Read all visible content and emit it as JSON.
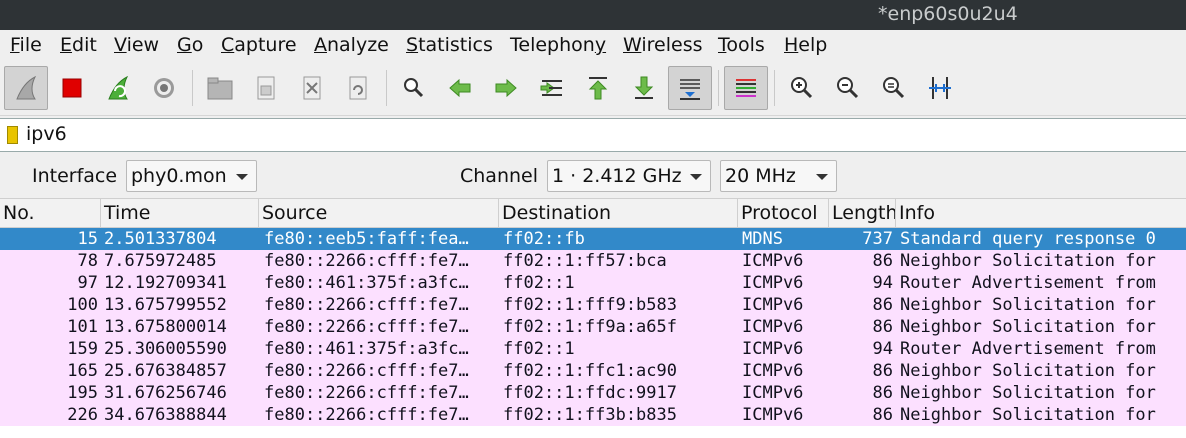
{
  "window": {
    "title": "*enp60s0u2u4"
  },
  "menu": [
    {
      "label": "File",
      "accel": "F",
      "rest": "ile"
    },
    {
      "label": "Edit",
      "accel": "E",
      "rest": "dit"
    },
    {
      "label": "View",
      "accel": "V",
      "rest": "iew"
    },
    {
      "label": "Go",
      "accel": "G",
      "rest": "o"
    },
    {
      "label": "Capture",
      "accel": "C",
      "rest": "apture"
    },
    {
      "label": "Analyze",
      "accel": "A",
      "rest": "nalyze"
    },
    {
      "label": "Statistics",
      "accel": "S",
      "rest": "tatistics"
    },
    {
      "label": "Telephony",
      "accel": "",
      "rest": "Telephon",
      "accel_after": "y"
    },
    {
      "label": "Wireless",
      "accel": "W",
      "rest": "ireless"
    },
    {
      "label": "Tools",
      "accel": "T",
      "rest": "ools"
    },
    {
      "label": "Help",
      "accel": "H",
      "rest": "elp"
    }
  ],
  "toolbar": {
    "icons": [
      "shark-fin-icon",
      "stop-icon",
      "restart-icon",
      "gear-icon",
      "open-folder-icon",
      "save-file-icon",
      "close-file-icon",
      "reload-icon",
      "find-icon",
      "go-back-icon",
      "go-forward-icon",
      "go-to-packet-icon",
      "first-packet-icon",
      "last-packet-icon",
      "autoscroll-icon",
      "colorize-icon",
      "zoom-in-icon",
      "zoom-out-icon",
      "normal-size-icon",
      "resize-columns-icon"
    ]
  },
  "filter": {
    "value": "ipv6"
  },
  "wireless": {
    "interface_label": "Interface",
    "interface_value": "phy0.mon",
    "channel_label": "Channel",
    "channel_value": "1 · 2.412 GHz",
    "width_value": "20 MHz"
  },
  "columns": [
    "No.",
    "Time",
    "Source",
    "Destination",
    "Protocol",
    "Length",
    "Info"
  ],
  "packets": [
    {
      "no": "15",
      "time": "2.501337804",
      "src": "fe80::eeb5:faff:fea…",
      "dst": "ff02::fb",
      "proto": "MDNS",
      "len": "737",
      "info": "Standard query response 0",
      "selected": true
    },
    {
      "no": "78",
      "time": "7.675972485",
      "src": "fe80::2266:cfff:fe7…",
      "dst": "ff02::1:ff57:bca",
      "proto": "ICMPv6",
      "len": "86",
      "info": "Neighbor Solicitation for"
    },
    {
      "no": "97",
      "time": "12.192709341",
      "src": "fe80::461:375f:a3fc…",
      "dst": "ff02::1",
      "proto": "ICMPv6",
      "len": "94",
      "info": "Router Advertisement from"
    },
    {
      "no": "100",
      "time": "13.675799552",
      "src": "fe80::2266:cfff:fe7…",
      "dst": "ff02::1:fff9:b583",
      "proto": "ICMPv6",
      "len": "86",
      "info": "Neighbor Solicitation for"
    },
    {
      "no": "101",
      "time": "13.675800014",
      "src": "fe80::2266:cfff:fe7…",
      "dst": "ff02::1:ff9a:a65f",
      "proto": "ICMPv6",
      "len": "86",
      "info": "Neighbor Solicitation for"
    },
    {
      "no": "159",
      "time": "25.306005590",
      "src": "fe80::461:375f:a3fc…",
      "dst": "ff02::1",
      "proto": "ICMPv6",
      "len": "94",
      "info": "Router Advertisement from"
    },
    {
      "no": "165",
      "time": "25.676384857",
      "src": "fe80::2266:cfff:fe7…",
      "dst": "ff02::1:ffc1:ac90",
      "proto": "ICMPv6",
      "len": "86",
      "info": "Neighbor Solicitation for"
    },
    {
      "no": "195",
      "time": "31.676256746",
      "src": "fe80::2266:cfff:fe7…",
      "dst": "ff02::1:ffdc:9917",
      "proto": "ICMPv6",
      "len": "86",
      "info": "Neighbor Solicitation for"
    },
    {
      "no": "226",
      "time": "34.676388844",
      "src": "fe80::2266:cfff:fe7…",
      "dst": "ff02::1:ff3b:b835",
      "proto": "ICMPv6",
      "len": "86",
      "info": "Neighbor Solicitation for"
    }
  ],
  "colors": {
    "row_bg": "#fce0ff",
    "selected_bg": "#3289c9",
    "titlebar_bg": "#2e3336"
  }
}
